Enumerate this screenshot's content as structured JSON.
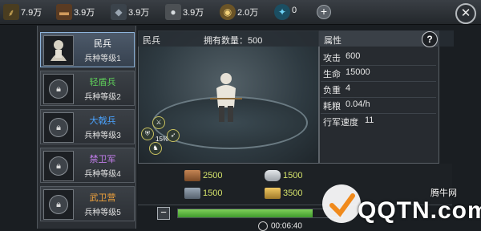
{
  "resources": [
    {
      "icon": "wheat-icon",
      "value": "7.9万",
      "color": "#c9a24a"
    },
    {
      "icon": "wood-log-icon",
      "value": "3.9万",
      "color": "#9a6a3c"
    },
    {
      "icon": "iron-ingot-icon",
      "value": "3.9万",
      "color": "#6e7a86"
    },
    {
      "icon": "stone-icon",
      "value": "3.9万",
      "color": "#b8bcc0"
    },
    {
      "icon": "coin-icon",
      "value": "2.0万",
      "color": "#d8b45a"
    },
    {
      "icon": "gem-icon",
      "value": "0",
      "color": "#3aa6c9"
    }
  ],
  "add_label": "+",
  "close_label": "✕",
  "units": [
    {
      "name": "民兵",
      "level": "兵种等级1",
      "name_color": "#ffffff",
      "locked": false
    },
    {
      "name": "轻盾兵",
      "level": "兵种等级2",
      "name_color": "#5fd15a",
      "locked": true
    },
    {
      "name": "大戟兵",
      "level": "兵种等级3",
      "name_color": "#4aa3ff",
      "locked": true
    },
    {
      "name": "禁卫军",
      "level": "兵种等级4",
      "name_color": "#c07ce8",
      "locked": true
    },
    {
      "name": "武卫营",
      "level": "兵种等级5",
      "name_color": "#f0a23c",
      "locked": true
    }
  ],
  "stage": {
    "unit_name": "民兵",
    "owned": "拥有数量：500",
    "skill_percent": "15%"
  },
  "attributes": {
    "title": "属性",
    "help": "?",
    "rows": [
      {
        "key": "攻击",
        "value": "600"
      },
      {
        "key": "生命",
        "value": "15000"
      },
      {
        "key": "负重",
        "value": "4"
      },
      {
        "key": "耗粮",
        "value": "0.04/h"
      },
      {
        "key": "行军速度",
        "value": "11"
      }
    ]
  },
  "costs": [
    {
      "icon": "wood-log-icon",
      "value": "2500",
      "color": "#a56a3a"
    },
    {
      "icon": "stone-icon",
      "value": "1500",
      "color": "#c8ccd0"
    },
    {
      "icon": "iron-ingot-icon",
      "value": "1500",
      "color": "#7a8896"
    },
    {
      "icon": "wheat-icon",
      "value": "3500",
      "color": "#d2a847"
    }
  ],
  "recruit": {
    "minus_label": "−",
    "progress": 0.82,
    "timer": "00:06:40"
  },
  "watermark": {
    "text": "QQTN.com",
    "small": "腾牛网"
  }
}
